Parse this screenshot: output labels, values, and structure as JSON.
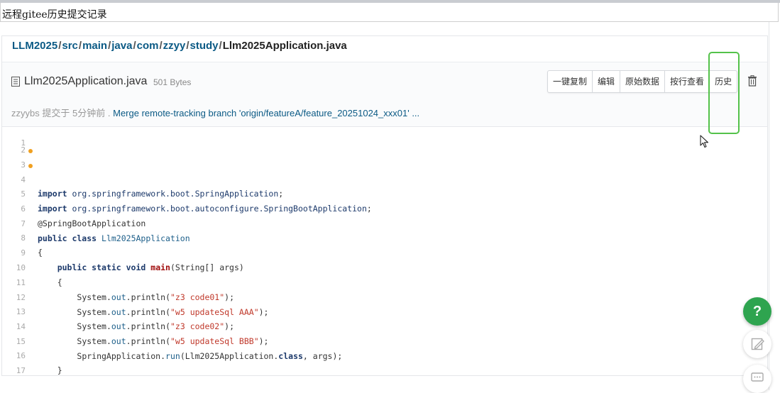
{
  "caption": "远程gitee历史提交记录",
  "breadcrumb": {
    "segments": [
      "LLM2025",
      "src",
      "main",
      "java",
      "com",
      "zzyy",
      "study"
    ],
    "separator": "/",
    "current": "Llm2025Application.java"
  },
  "file": {
    "name": "Llm2025Application.java",
    "size": "501 Bytes",
    "icon": "file-text-icon"
  },
  "toolbar": {
    "copy_label": "一键复制",
    "edit_label": "编辑",
    "raw_label": "原始数据",
    "blame_label": "按行查看",
    "history_label": "历史",
    "delete_icon": "trash-icon"
  },
  "commit": {
    "author": "zzyybs",
    "action": "提交于",
    "time": "5分钟前",
    "separator": ".",
    "message": "Merge remote-tracking branch 'origin/featureA/feature_20251024_xxx01' ..."
  },
  "code": {
    "ln1": "1",
    "ln2": "2",
    "ln3": "3",
    "ln4": "4",
    "ln5": "5",
    "ln6": "6",
    "ln7": "7",
    "ln8": "8",
    "ln9": "9",
    "ln10": "10",
    "ln11": "11",
    "ln12": "12",
    "ln13": "13",
    "ln14": "14",
    "ln15": "15",
    "ln16": "16",
    "ln17": "17",
    "import": "import",
    "pkg_app": "org.springframework.boot.SpringApplication",
    "pkg_auto": "org.springframework.boot.autoconfigure.SpringBootApplication",
    "semi": ";",
    "annotation": "@SpringBootApplication",
    "public_class": "public class",
    "class_name": "Llm2025Application",
    "brace_open": "{",
    "brace_close": "}",
    "main_mods": "public static void",
    "main_name": "main",
    "main_params": "(String[] args)",
    "system": "System",
    "dot": ".",
    "out": "out",
    "println": "println",
    "paren_open": "(",
    "paren_close_semi": ");",
    "s1": "\"z3 code01\"",
    "s2": "\"w5 updateSql AAA\"",
    "s3": "\"z3 code02\"",
    "s4": "\"w5 updateSql BBB\"",
    "spring_app": "SpringApplication",
    "run": "run",
    "run_args_a": "(Llm2025Application.",
    "class_kw": "class",
    "run_args_b": ", args);"
  },
  "help": {
    "label": "?"
  },
  "colors": {
    "accent_green": "#2ea44f",
    "highlight_green": "#54c24a",
    "link_blue": "#0b5a85",
    "modified_dot": "#f0a020",
    "string_red": "#c0392b"
  }
}
